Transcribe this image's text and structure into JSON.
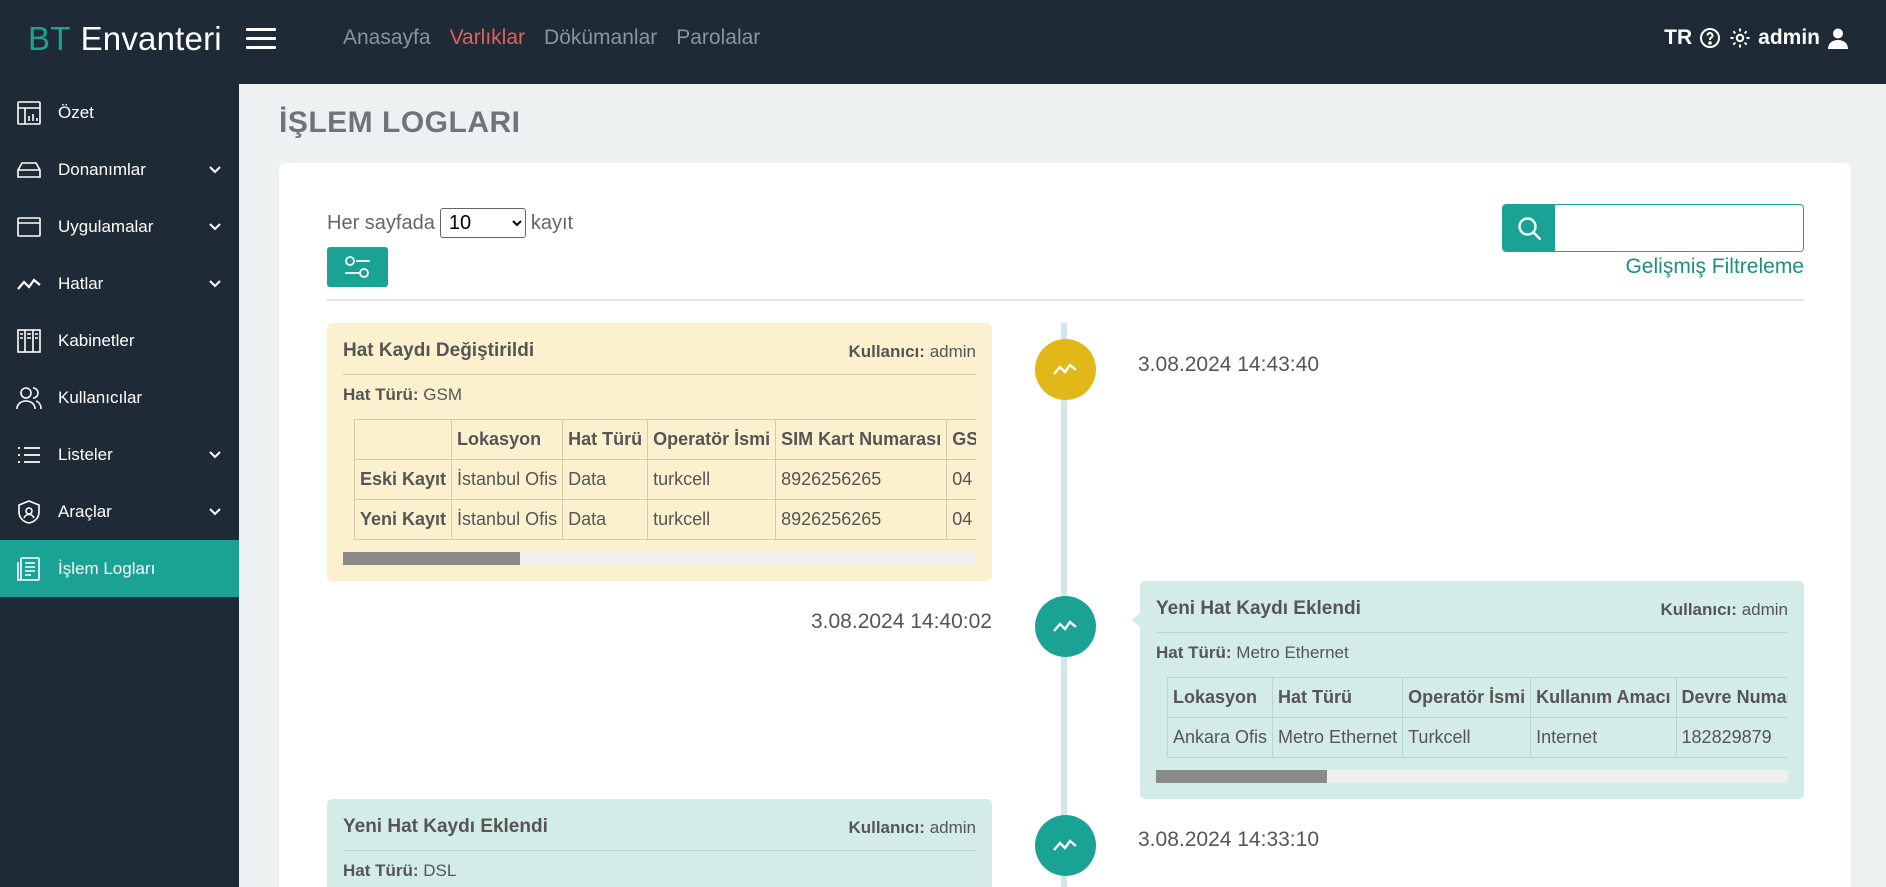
{
  "brand": {
    "prefix": "BT",
    "name": "Envanteri"
  },
  "topnav": [
    {
      "label": "Anasayfa",
      "active": false
    },
    {
      "label": "Varlıklar",
      "active": true
    },
    {
      "label": "Dökümanlar",
      "active": false
    },
    {
      "label": "Parolalar",
      "active": false
    }
  ],
  "topright": {
    "lang": "TR",
    "user": "admin"
  },
  "sidebar": {
    "items": [
      {
        "label": "Özet",
        "icon": "dashboard-icon",
        "has_children": false
      },
      {
        "label": "Donanımlar",
        "icon": "hardware-icon",
        "has_children": true
      },
      {
        "label": "Uygulamalar",
        "icon": "window-icon",
        "has_children": true
      },
      {
        "label": "Hatlar",
        "icon": "line-chart-icon",
        "has_children": true
      },
      {
        "label": "Kabinetler",
        "icon": "cabinet-icon",
        "has_children": false
      },
      {
        "label": "Kullanıcılar",
        "icon": "users-icon",
        "has_children": false
      },
      {
        "label": "Listeler",
        "icon": "list-icon",
        "has_children": true
      },
      {
        "label": "Araçlar",
        "icon": "shield-icon",
        "has_children": true
      },
      {
        "label": "İşlem Logları",
        "icon": "document-icon",
        "has_children": false,
        "active": true
      }
    ]
  },
  "page": {
    "title": "İŞLEM LOGLARI"
  },
  "controls": {
    "per_page_prefix": "Her sayfada",
    "per_page_value": "10",
    "per_page_suffix": "kayıt",
    "search_placeholder": "",
    "advanced_filter": "Gelişmiş Filtreleme"
  },
  "logs": [
    {
      "title": "Hat Kaydı Değiştirildi",
      "user_label": "Kullanıcı:",
      "user": "admin",
      "type_label": "Hat Türü:",
      "type": "GSM",
      "date": "3.08.2024 14:43:40",
      "columns": [
        "",
        "Lokasyon",
        "Hat Türü",
        "Operatör İsmi",
        "SIM Kart Numarası",
        "GSM"
      ],
      "rows": [
        [
          "Eski Kayıt",
          "İstanbul Ofis",
          "Data",
          "turkcell",
          "8926256265",
          "04"
        ],
        [
          "Yeni Kayıt",
          "İstanbul Ofis",
          "Data",
          "turkcell",
          "8926256265",
          "04"
        ]
      ],
      "scroll_fraction": 0.28
    },
    {
      "title": "Yeni Hat Kaydı Eklendi",
      "user_label": "Kullanıcı:",
      "user": "admin",
      "type_label": "Hat Türü:",
      "type": "Metro Ethernet",
      "date": "3.08.2024 14:40:02",
      "columns": [
        "Lokasyon",
        "Hat Türü",
        "Operatör İsmi",
        "Kullanım Amacı",
        "Devre Numarası"
      ],
      "rows": [
        [
          "Ankara Ofis",
          "Metro Ethernet",
          "Turkcell",
          "Internet",
          "182829879"
        ]
      ],
      "scroll_fraction": 0.27
    },
    {
      "title": "Yeni Hat Kaydı Eklendi",
      "user_label": "Kullanıcı:",
      "user": "admin",
      "type_label": "Hat Türü:",
      "type": "DSL",
      "date": "3.08.2024 14:33:10"
    }
  ],
  "colors": {
    "accent": "#1aa394",
    "danger": "#e4605a",
    "warning_dot": "#e2b818",
    "dark": "#1e2a35"
  }
}
